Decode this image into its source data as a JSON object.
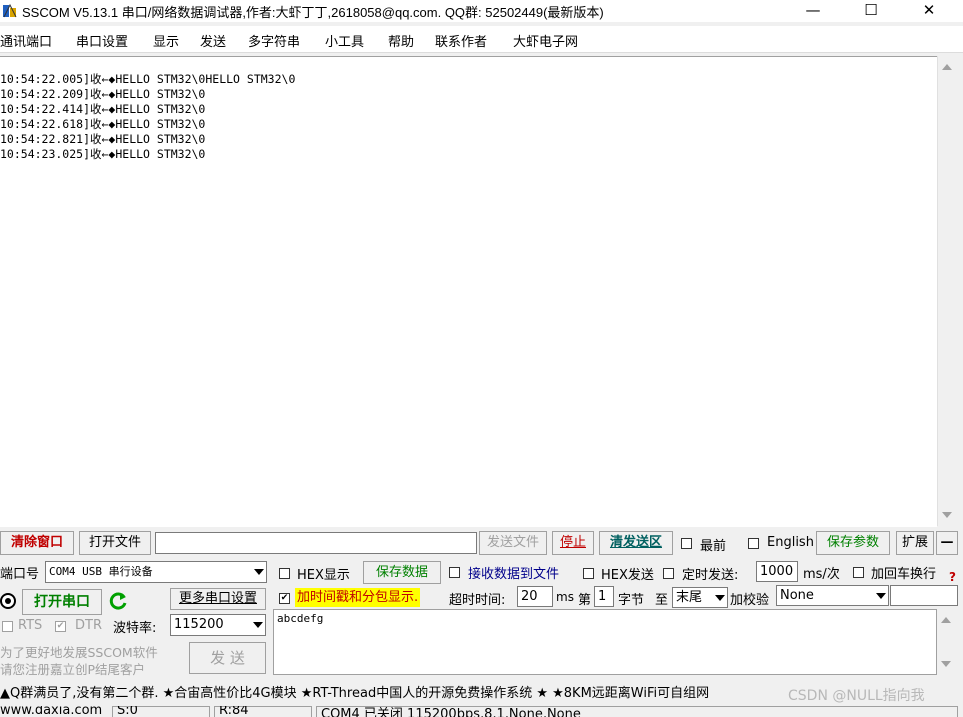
{
  "window": {
    "title": "SSCOM V5.13.1 串口/网络数据调试器,作者:大虾丁丁,2618058@qq.com. QQ群: 52502449(最新版本)",
    "minimize": "—",
    "maximize": "☐",
    "close": "✕"
  },
  "menu": [
    "通讯端口",
    "串口设置",
    "显示",
    "发送",
    "多字符串",
    "小工具",
    "帮助",
    "联系作者",
    "大虾电子网"
  ],
  "receive": {
    "lines": [
      "10:54:22.005]收←◆HELLO STM32\\0HELLO STM32\\0",
      "10:54:22.209]收←◆HELLO STM32\\0",
      "10:54:22.414]收←◆HELLO STM32\\0",
      "10:54:22.618]收←◆HELLO STM32\\0",
      "10:54:22.821]收←◆HELLO STM32\\0",
      "10:54:23.025]收←◆HELLO STM32\\0"
    ]
  },
  "toolbar": {
    "clear_window": "清除窗口",
    "open_file": "打开文件",
    "file_path": "",
    "send_file": "发送文件",
    "stop": "停止",
    "clear_send": "清发送区",
    "topmost": "最前",
    "english": "English",
    "save_params": "保存参数",
    "expand": "扩展",
    "collapse": "—"
  },
  "port": {
    "label": "端口号",
    "value": "COM4 USB 串行设备",
    "open_button": "打开串口",
    "more_settings": "更多串口设置",
    "rts": "RTS",
    "dtr": "DTR",
    "baud_label": "波特率:",
    "baud_value": "115200"
  },
  "options": {
    "hex_display": "HEX显示",
    "save_data": "保存数据",
    "recv_to_file": "接收数据到文件",
    "hex_send": "HEX发送",
    "timed_send": "定时发送:",
    "interval": "1000",
    "interval_unit": "ms/次",
    "add_crlf": "加回车换行",
    "timestamp": "加时间戳和分包显示.",
    "timeout_label": "超时时间:",
    "timeout_value": "20",
    "timeout_unit": "ms",
    "nth_label": "第",
    "nth_value": "1",
    "byte_label": "字节",
    "to_label": "至",
    "end_value": "末尾",
    "checksum_label": "加校验",
    "checksum_value": "None"
  },
  "send": {
    "text": "abcdefg",
    "send_button": "发 送"
  },
  "promo": {
    "line1": "为了更好地发展SSCOM软件",
    "line2": "请您注册嘉立创P结尾客户"
  },
  "ticker": "▲Q群满员了,没有第二个群. ★合宙高性价比4G模块 ★RT-Thread中国人的开源免费操作系统 ★ ★8KM远距离WiFi可自组网",
  "watermark": "CSDN @NULL指向我",
  "status": {
    "site": "www.daxia.com",
    "s": "S:0",
    "r": "R:84",
    "port_state": "COM4 已关闭  115200bps,8,1,None,None"
  },
  "colors": {
    "highlight": "#ffff00",
    "accent_red": "#c00000",
    "accent_green": "#008000"
  }
}
